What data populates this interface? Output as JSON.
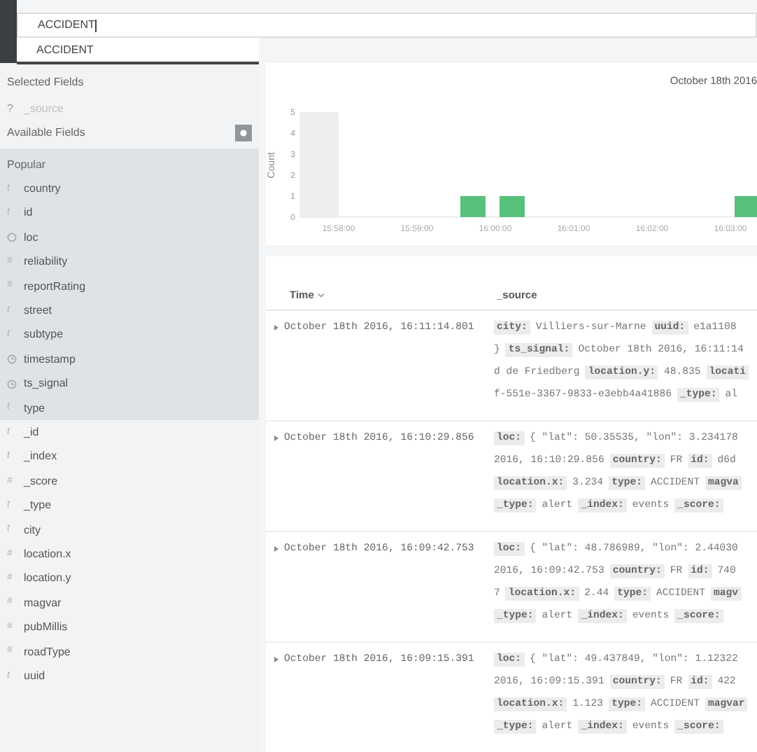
{
  "search": {
    "value": "ACCIDENT"
  },
  "suggestions": [
    "ACCIDENT"
  ],
  "sidebar": {
    "selected_title": "Selected Fields",
    "selected_fields": [
      {
        "name": "_source",
        "kind": "unknown",
        "glyph": "?"
      }
    ],
    "available_title": "Available Fields",
    "popular_title": "Popular",
    "popular_fields": [
      {
        "name": "country",
        "kind": "string",
        "glyph": "t"
      },
      {
        "name": "id",
        "kind": "string",
        "glyph": "t"
      },
      {
        "name": "loc",
        "kind": "geo"
      },
      {
        "name": "reliability",
        "kind": "number",
        "glyph": "#"
      },
      {
        "name": "reportRating",
        "kind": "number",
        "glyph": "#"
      },
      {
        "name": "street",
        "kind": "string",
        "glyph": "t"
      },
      {
        "name": "subtype",
        "kind": "string",
        "glyph": "t"
      },
      {
        "name": "timestamp",
        "kind": "date"
      },
      {
        "name": "ts_signal",
        "kind": "date"
      },
      {
        "name": "type",
        "kind": "string",
        "glyph": "t"
      }
    ],
    "other_fields": [
      {
        "name": "_id",
        "kind": "string",
        "glyph": "t"
      },
      {
        "name": "_index",
        "kind": "string",
        "glyph": "t"
      },
      {
        "name": "_score",
        "kind": "number",
        "glyph": "#"
      },
      {
        "name": "_type",
        "kind": "string",
        "glyph": "t"
      },
      {
        "name": "city",
        "kind": "string",
        "glyph": "t"
      },
      {
        "name": "location.x",
        "kind": "number",
        "glyph": "#"
      },
      {
        "name": "location.y",
        "kind": "number",
        "glyph": "#"
      },
      {
        "name": "magvar",
        "kind": "number",
        "glyph": "#"
      },
      {
        "name": "pubMillis",
        "kind": "number",
        "glyph": "#"
      },
      {
        "name": "roadType",
        "kind": "number",
        "glyph": "#"
      },
      {
        "name": "uuid",
        "kind": "string",
        "glyph": "t"
      }
    ]
  },
  "histogram": {
    "range_title": "October 18th 2016",
    "chart_data": {
      "type": "bar",
      "ylabel": "Count",
      "categories": [
        null,
        "15:58:00",
        null,
        "15:59:00",
        null,
        "16:00:00",
        null,
        "16:01:00",
        null,
        "16:02:00",
        null,
        "16:03:00"
      ],
      "series": [
        {
          "color": "#eeeeee",
          "values": [
            5,
            null,
            null,
            null,
            null,
            null,
            null,
            null,
            null,
            null,
            null,
            null
          ]
        },
        {
          "color": "#57c17b",
          "values": [
            null,
            null,
            null,
            null,
            1,
            1,
            null,
            null,
            null,
            null,
            null,
            1
          ]
        }
      ],
      "ylim": [
        0,
        5
      ],
      "yticks": [
        0,
        1,
        2,
        3,
        4,
        5
      ]
    }
  },
  "table": {
    "columns": [
      "Time",
      "_source"
    ],
    "rows": [
      {
        "time": "October 18th 2016, 16:11:14.801",
        "lines": [
          [
            {
              "kind": "key",
              "text": "city:"
            },
            {
              "kind": "value",
              "text": "Villiers-sur-Marne"
            },
            {
              "kind": "key",
              "text": "uuid:"
            },
            {
              "kind": "value",
              "text": "e1a1108"
            }
          ],
          [
            {
              "kind": "value",
              "text": "}"
            },
            {
              "kind": "key",
              "text": "ts_signal:"
            },
            {
              "kind": "value",
              "text": "October 18th 2016, 16:11:14"
            }
          ],
          [
            {
              "kind": "value",
              "text": "d de Friedberg"
            },
            {
              "kind": "key",
              "text": "location.y:"
            },
            {
              "kind": "value",
              "text": "48.835"
            },
            {
              "kind": "key",
              "text": "locati"
            }
          ],
          [
            {
              "kind": "value",
              "text": "f-551e-3367-9833-e3ebb4a41886"
            },
            {
              "kind": "key",
              "text": "_type:"
            },
            {
              "kind": "value",
              "text": "al"
            }
          ]
        ]
      },
      {
        "time": "October 18th 2016, 16:10:29.856",
        "lines": [
          [
            {
              "kind": "key",
              "text": "loc:"
            },
            {
              "kind": "value",
              "text": "{ \"lat\": 50.35535, \"lon\": 3.234178"
            }
          ],
          [
            {
              "kind": "value",
              "text": "2016, 16:10:29.856"
            },
            {
              "kind": "key",
              "text": "country:"
            },
            {
              "kind": "value",
              "text": "FR"
            },
            {
              "kind": "key",
              "text": "id:"
            },
            {
              "kind": "value",
              "text": "d6d"
            }
          ],
          [
            {
              "kind": "key",
              "text": "location.x:"
            },
            {
              "kind": "value",
              "text": "3.234"
            },
            {
              "kind": "key",
              "text": "type:"
            },
            {
              "kind": "value",
              "text": "ACCIDENT"
            },
            {
              "kind": "key",
              "text": "magva"
            }
          ],
          [
            {
              "kind": "key",
              "text": "_type:"
            },
            {
              "kind": "value",
              "text": "alert"
            },
            {
              "kind": "key",
              "text": "_index:"
            },
            {
              "kind": "value",
              "text": "events"
            },
            {
              "kind": "key",
              "text": "_score:"
            }
          ]
        ]
      },
      {
        "time": "October 18th 2016, 16:09:42.753",
        "lines": [
          [
            {
              "kind": "key",
              "text": "loc:"
            },
            {
              "kind": "value",
              "text": "{ \"lat\": 48.786989, \"lon\": 2.44030"
            }
          ],
          [
            {
              "kind": "value",
              "text": "2016, 16:09:42.753"
            },
            {
              "kind": "key",
              "text": "country:"
            },
            {
              "kind": "value",
              "text": "FR"
            },
            {
              "kind": "key",
              "text": "id:"
            },
            {
              "kind": "value",
              "text": "740"
            }
          ],
          [
            {
              "kind": "value",
              "text": "7"
            },
            {
              "kind": "key",
              "text": "location.x:"
            },
            {
              "kind": "value",
              "text": "2.44"
            },
            {
              "kind": "key",
              "text": "type:"
            },
            {
              "kind": "value",
              "text": "ACCIDENT"
            },
            {
              "kind": "key",
              "text": "magv"
            }
          ],
          [
            {
              "kind": "key",
              "text": "_type:"
            },
            {
              "kind": "value",
              "text": "alert"
            },
            {
              "kind": "key",
              "text": "_index:"
            },
            {
              "kind": "value",
              "text": "events"
            },
            {
              "kind": "key",
              "text": "_score:"
            }
          ]
        ]
      },
      {
        "time": "October 18th 2016, 16:09:15.391",
        "lines": [
          [
            {
              "kind": "key",
              "text": "loc:"
            },
            {
              "kind": "value",
              "text": "{ \"lat\": 49.437849, \"lon\": 1.12322"
            }
          ],
          [
            {
              "kind": "value",
              "text": "2016, 16:09:15.391"
            },
            {
              "kind": "key",
              "text": "country:"
            },
            {
              "kind": "value",
              "text": "FR"
            },
            {
              "kind": "key",
              "text": "id:"
            },
            {
              "kind": "value",
              "text": "422"
            }
          ],
          [
            {
              "kind": "key",
              "text": "location.x:"
            },
            {
              "kind": "value",
              "text": "1.123"
            },
            {
              "kind": "key",
              "text": "type:"
            },
            {
              "kind": "value",
              "text": "ACCIDENT"
            },
            {
              "kind": "key",
              "text": "magvar"
            }
          ],
          [
            {
              "kind": "key",
              "text": "_type:"
            },
            {
              "kind": "value",
              "text": "alert"
            },
            {
              "kind": "key",
              "text": "_index:"
            },
            {
              "kind": "value",
              "text": "events"
            },
            {
              "kind": "key",
              "text": "_score:"
            }
          ]
        ]
      }
    ]
  }
}
